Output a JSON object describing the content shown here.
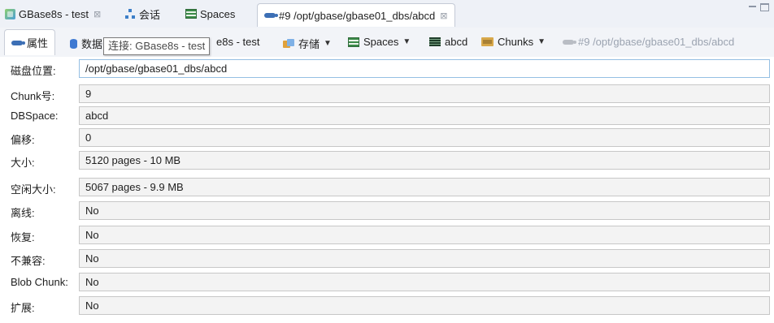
{
  "tabs": [
    {
      "label": "GBase8s - test",
      "icon": "database-icon",
      "closable": true,
      "active": false
    },
    {
      "label": "会话",
      "icon": "session-tree-icon",
      "closable": false,
      "active": false
    },
    {
      "label": "Spaces",
      "icon": "spaces-icon",
      "closable": false,
      "active": false
    },
    {
      "label": "#9 /opt/gbase/gbase01_dbs/abcd",
      "icon": "chunk-icon",
      "closable": true,
      "active": true
    }
  ],
  "close_glyph": "⊠",
  "breadcrumb": {
    "properties_label": "属性",
    "data_label": "数据",
    "connection_label": "e8s - test",
    "storage_label": "存储",
    "spaces_label": "Spaces",
    "dbspace_label": "abcd",
    "chunks_label": "Chunks",
    "chunk_label": "#9 /opt/gbase/gbase01_dbs/abcd"
  },
  "tooltip": "连接: GBase8s - test",
  "properties": [
    {
      "label": "磁盘位置:",
      "value": "/opt/gbase/gbase01_dbs/abcd",
      "focused": true
    },
    {
      "label": "Chunk号:",
      "value": "9"
    },
    {
      "label": "DBSpace:",
      "value": "abcd"
    },
    {
      "label": "偏移:",
      "value": "0"
    },
    {
      "label": "大小:",
      "value": "5120 pages - 10 MB"
    },
    {
      "label": "空闲大小:",
      "value": "5067 pages - 9.9 MB"
    },
    {
      "label": "离线:",
      "value": "No"
    },
    {
      "label": "恢复:",
      "value": "No"
    },
    {
      "label": "不兼容:",
      "value": "No"
    },
    {
      "label": "Blob Chunk:",
      "value": "No"
    },
    {
      "label": "扩展:",
      "value": "No"
    }
  ],
  "colors": {
    "accent_blue": "#3c6fb5",
    "focus_border": "#95bfe3",
    "field_background": "#f3f3f3"
  }
}
